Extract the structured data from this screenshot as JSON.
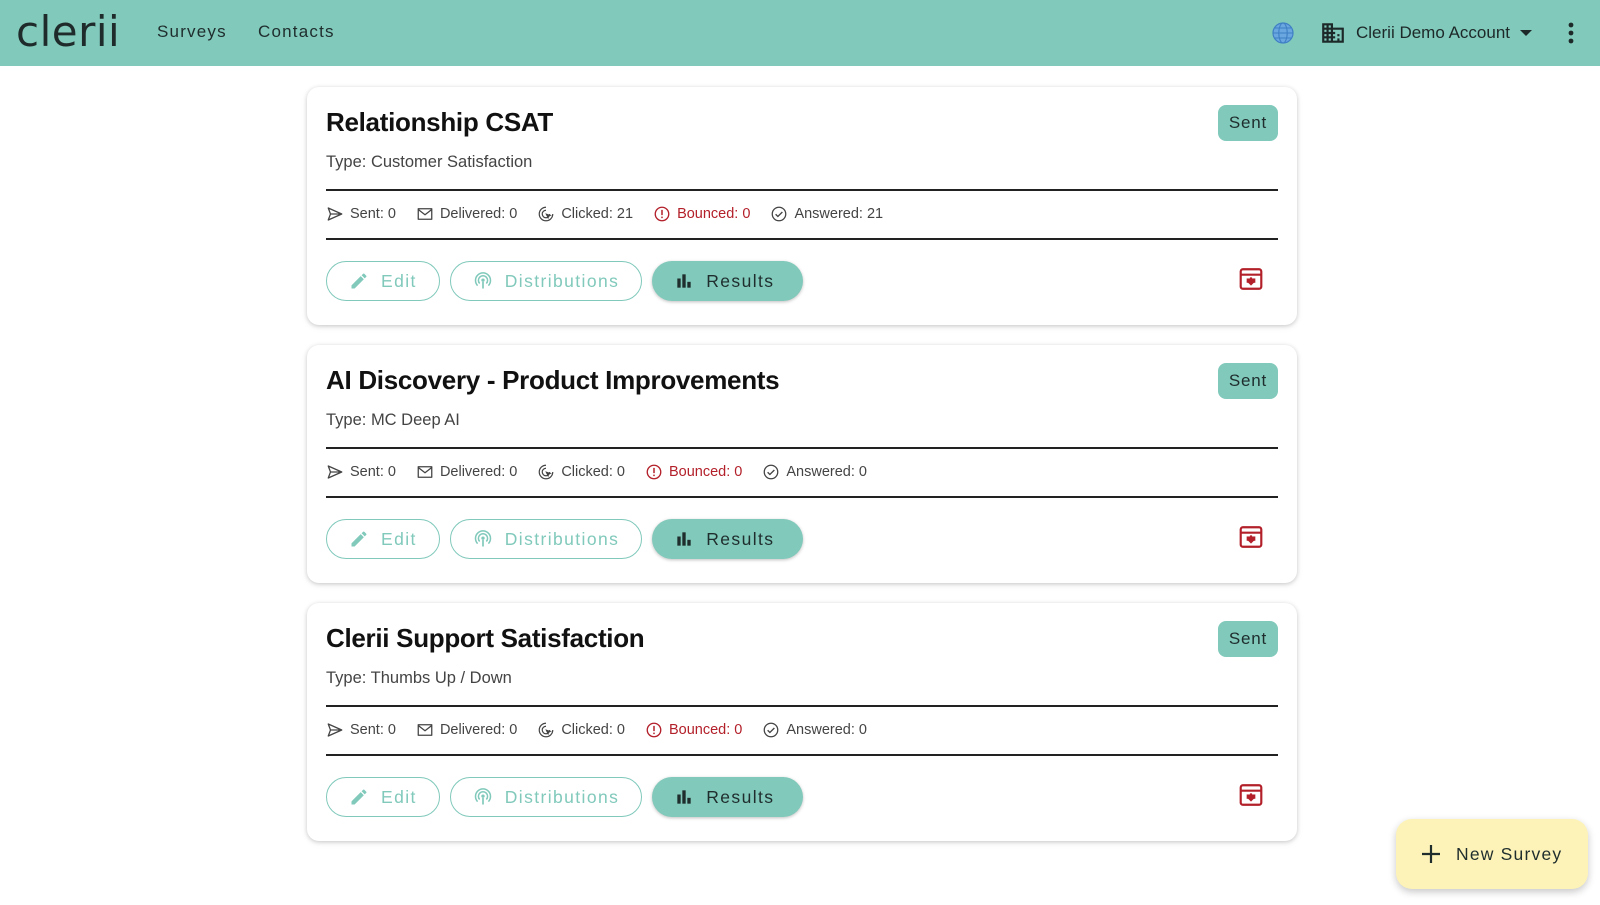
{
  "app": {
    "logo": "clerii"
  },
  "nav": {
    "surveys": "Surveys",
    "contacts": "Contacts"
  },
  "account": {
    "name": "Clerii Demo Account"
  },
  "icons": {
    "language": "globe-icon",
    "account": "building-icon",
    "menu": "more-vert-icon",
    "sent": "send-icon",
    "delivered": "mail-icon",
    "clicked": "click-icon",
    "bounced": "error-icon",
    "answered": "check-circle-icon",
    "edit": "pencil-icon",
    "distributions": "broadcast-icon",
    "results": "bar-chart-icon",
    "archive": "archive-icon",
    "add": "plus-icon"
  },
  "colors": {
    "accent": "#80c9bb",
    "danger": "#b3202a",
    "fab": "#fdf3b8"
  },
  "surveys": [
    {
      "title": "Relationship CSAT",
      "type": "Type: Customer Satisfaction",
      "status": "Sent",
      "stats": {
        "sent": "Sent: 0",
        "delivered": "Delivered: 0",
        "clicked": "Clicked: 21",
        "bounced": "Bounced: 0",
        "answered": "Answered: 21"
      },
      "actions": {
        "edit": "Edit",
        "distributions": "Distributions",
        "results": "Results"
      }
    },
    {
      "title": "AI Discovery - Product Improvements",
      "type": "Type: MC Deep AI",
      "status": "Sent",
      "stats": {
        "sent": "Sent: 0",
        "delivered": "Delivered: 0",
        "clicked": "Clicked: 0",
        "bounced": "Bounced: 0",
        "answered": "Answered: 0"
      },
      "actions": {
        "edit": "Edit",
        "distributions": "Distributions",
        "results": "Results"
      }
    },
    {
      "title": "Clerii Support Satisfaction",
      "type": "Type: Thumbs Up / Down",
      "status": "Sent",
      "stats": {
        "sent": "Sent: 0",
        "delivered": "Delivered: 0",
        "clicked": "Clicked: 0",
        "bounced": "Bounced: 0",
        "answered": "Answered: 0"
      },
      "actions": {
        "edit": "Edit",
        "distributions": "Distributions",
        "results": "Results"
      }
    }
  ],
  "fab": {
    "label": "New Survey"
  }
}
